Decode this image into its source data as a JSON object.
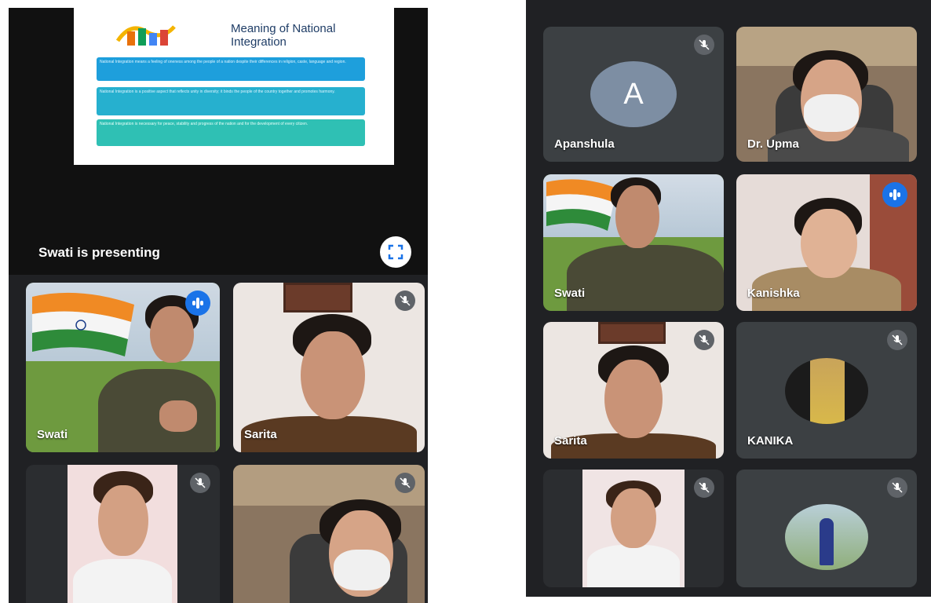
{
  "left_screen": {
    "slide": {
      "title": "Meaning of National Integration",
      "paragraphs": [
        "National Integration means a feeling of oneness among the people of a nation despite their differences in religion, caste, language and region.",
        "National Integration is a positive aspect that reflects unity in diversity; it binds the people of the country together and promotes harmony.",
        "National Integration is necessary for peace, stability and progress of the nation and for the development of every citizen."
      ]
    },
    "presenting_label": "Swati is presenting",
    "participants": [
      {
        "name": "Swati",
        "status": "speaking"
      },
      {
        "name": "Sarita",
        "status": "muted"
      },
      {
        "name": "",
        "status": "muted"
      },
      {
        "name": "",
        "status": "muted"
      }
    ]
  },
  "right_screen": {
    "participants": [
      {
        "name": "Apanshula",
        "initial": "A",
        "status": "muted"
      },
      {
        "name": "Dr. Upma",
        "status": "none"
      },
      {
        "name": "Swati",
        "status": "none"
      },
      {
        "name": "Kanishka",
        "status": "speaking"
      },
      {
        "name": "Sarita",
        "status": "muted"
      },
      {
        "name": "KANIKA",
        "status": "muted"
      },
      {
        "name": "",
        "status": "muted"
      },
      {
        "name": "",
        "status": "muted"
      }
    ]
  },
  "colors": {
    "background": "#202124",
    "tile": "#3c4043",
    "speaking": "#1a73e8",
    "avatar_a": "#7d8ea3",
    "slide_box": "#29a8df"
  },
  "icons": [
    "mic-off-icon",
    "speaking-indicator-icon",
    "fullscreen-icon",
    "flag-icon"
  ]
}
